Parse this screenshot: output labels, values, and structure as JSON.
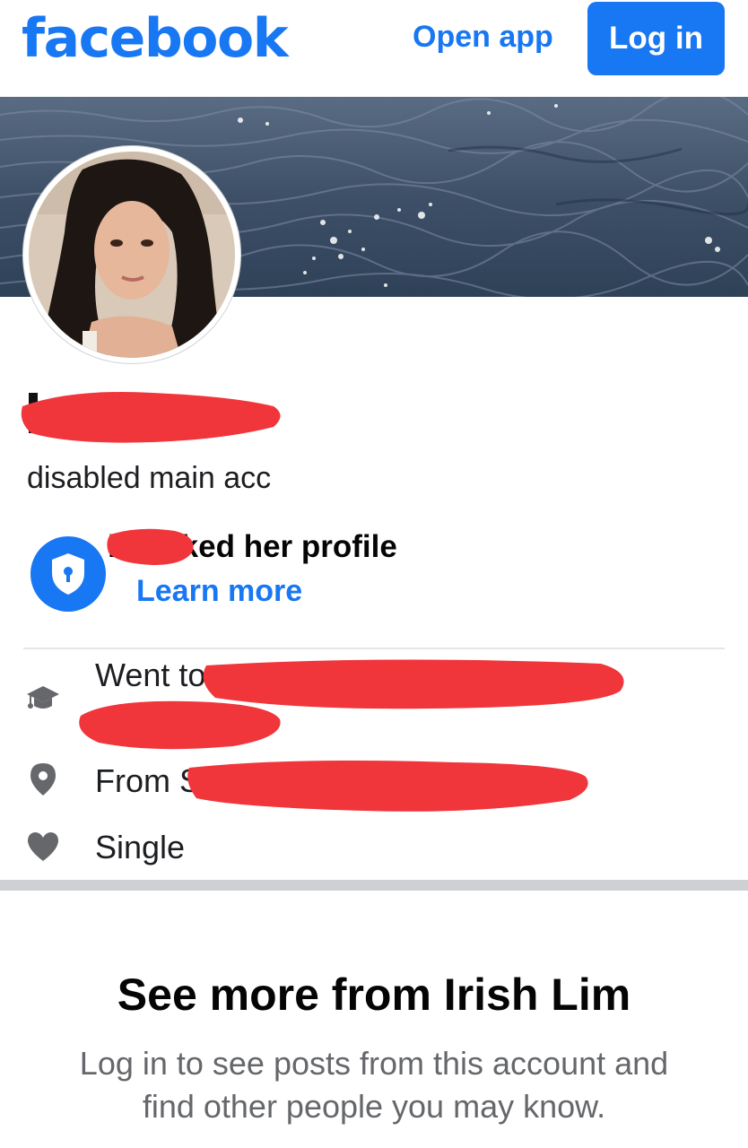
{
  "header": {
    "logo": "facebook",
    "open_app": "Open app",
    "login": "Log in"
  },
  "profile": {
    "bio": "disabled main acc",
    "lock_message": "h locked her profile",
    "learn_more": "Learn more"
  },
  "about": {
    "education": "Went to",
    "hometown": "From S",
    "relationship": "Single"
  },
  "cta": {
    "title": "See more from Irish Lim",
    "subtitle": "Log in to see posts from this account and find other people you may know."
  },
  "colors": {
    "brand": "#1877f2",
    "redaction": "#f0353b"
  },
  "icons": [
    "graduation-cap-icon",
    "location-pin-icon",
    "heart-icon",
    "shield-lock-icon"
  ]
}
